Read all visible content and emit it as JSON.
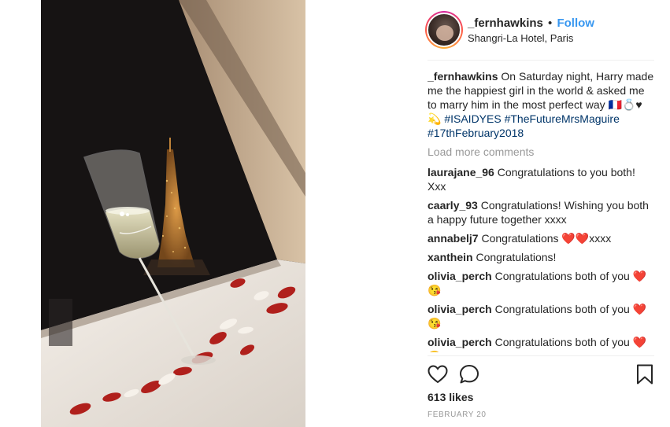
{
  "post": {
    "username": "_fernhawkins",
    "separator": "•",
    "follow_label": "Follow",
    "location": "Shangri-La Hotel, Paris"
  },
  "caption": {
    "username": "_fernhawkins",
    "text": "On Saturday night, Harry made me the happiest girl in the world & asked me to marry him in the most perfect way 🇫🇷💍♥💫",
    "hashtags": [
      "#ISAIDYES",
      "#TheFutureMrsMaguire",
      "#17thFebruary2018"
    ]
  },
  "load_more_label": "Load more comments",
  "comments": [
    {
      "user": "laurajane_96",
      "text": "Congratulations to you both! Xxx"
    },
    {
      "user": "caarly_93",
      "text": "Congratulations! Wishing you both a happy future together xxxx"
    },
    {
      "user": "annabelj7",
      "text": "Congratulations ❤️❤️xxxx"
    },
    {
      "user": "xanthein",
      "text": "Congratulations!"
    },
    {
      "user": "olivia_perch",
      "text": "Congratulations both of you ❤️😘"
    },
    {
      "user": "olivia_perch",
      "text": "Congratulations both of you ❤️😘"
    },
    {
      "user": "olivia_perch",
      "text": "Congratulations both of you ❤️😘"
    }
  ],
  "actions": {
    "like_icon": "heart-outline-icon",
    "comment_icon": "speech-bubble-icon",
    "save_icon": "bookmark-icon"
  },
  "likes_label": "613 likes",
  "date_label": "FEBRUARY 20",
  "colors": {
    "link_blue": "#3897f0",
    "hashtag": "#003569",
    "muted": "#999999",
    "text": "#262626"
  }
}
